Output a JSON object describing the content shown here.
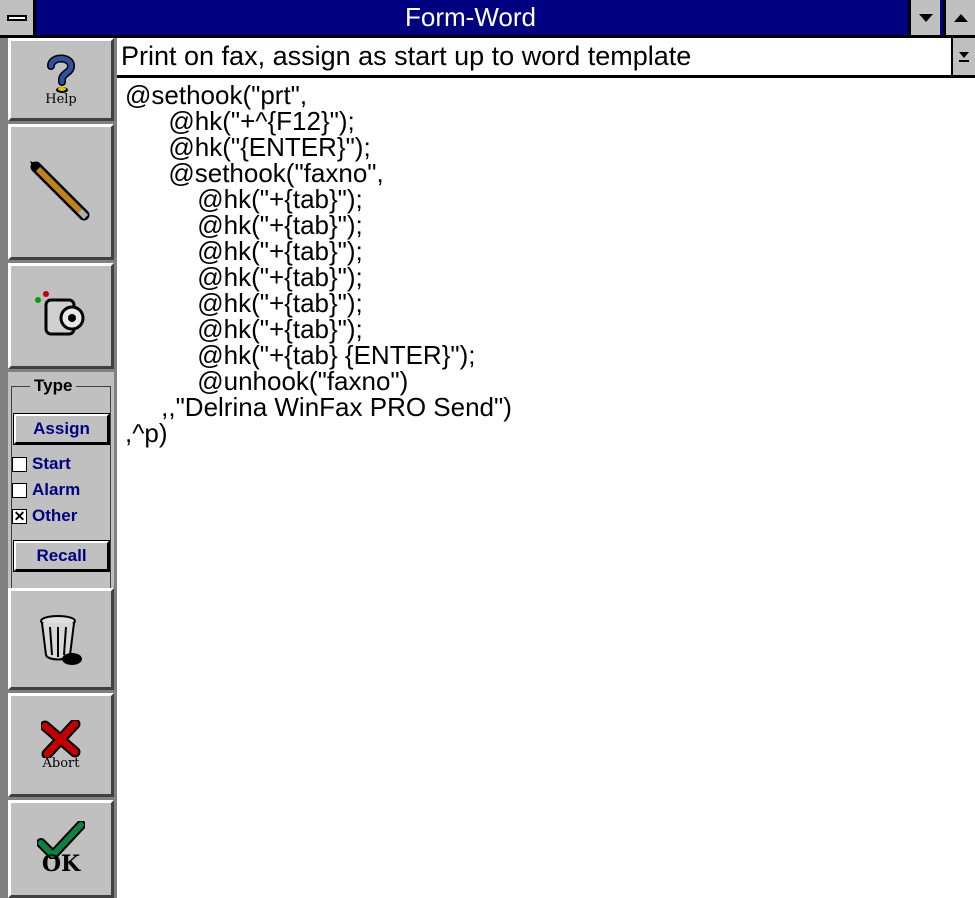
{
  "window": {
    "title": "Form-Word"
  },
  "template_selector": {
    "value": "Print on fax, assign as start up to word template"
  },
  "sidebar": {
    "help_label": "Help",
    "type_group": {
      "label": "Type",
      "assign_label": "Assign",
      "start_label": "Start",
      "start_checked": false,
      "alarm_label": "Alarm",
      "alarm_checked": false,
      "other_label": "Other",
      "other_checked": true,
      "other_mark": "✕",
      "recall_label": "Recall"
    },
    "abort_label": "Abort",
    "ok_label": "OK"
  },
  "editor": {
    "script": "@sethook(\"prt\",\n      @hk(\"+^{F12}\");\n      @hk(\"{ENTER}\");\n      @sethook(\"faxno\",\n          @hk(\"+{tab}\");\n          @hk(\"+{tab}\");\n          @hk(\"+{tab}\");\n          @hk(\"+{tab}\");\n          @hk(\"+{tab}\");\n          @hk(\"+{tab}\");\n          @hk(\"+{tab} {ENTER}\");\n          @unhook(\"faxno\")\n     ,,\"Delrina WinFax PRO Send\")\n,^p)"
  },
  "colors": {
    "titlebar": "#000080",
    "face": "#c0c0c0",
    "accent_text": "#000080",
    "help_icon": "#3050a0",
    "abort_icon": "#c00000",
    "ok_icon": "#108040"
  }
}
